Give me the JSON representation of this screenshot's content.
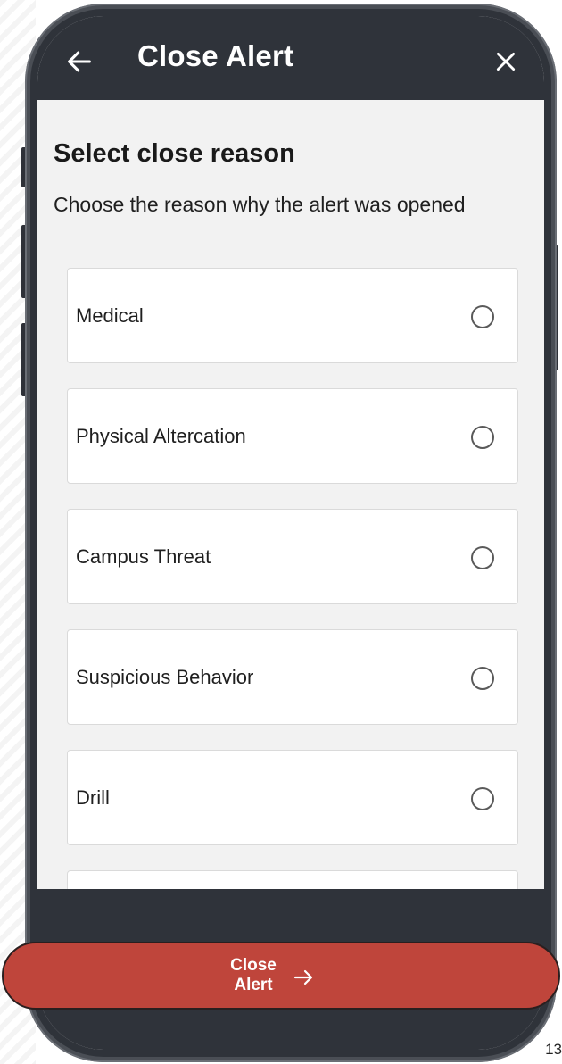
{
  "header": {
    "title": "Close Alert"
  },
  "main": {
    "heading": "Select close reason",
    "subheading": "Choose the reason why the alert was opened",
    "options": [
      {
        "label": "Medical",
        "selected": false
      },
      {
        "label": "Physical Altercation",
        "selected": false
      },
      {
        "label": "Campus Threat",
        "selected": false
      },
      {
        "label": "Suspicious Behavior",
        "selected": false
      },
      {
        "label": "Drill",
        "selected": false
      },
      {
        "label": "",
        "selected": false
      }
    ]
  },
  "footer": {
    "cta_label": "Close\nAlert"
  },
  "page_number": "13",
  "icons": {
    "back": "arrow-left-icon",
    "close": "close-icon",
    "cta_arrow": "arrow-right-icon",
    "radio": "radio-unchecked-icon"
  },
  "colors": {
    "app_bar": "#2f333a",
    "background": "#f2f2f2",
    "card": "#ffffff",
    "card_border": "#dadada",
    "cta": "#bf453b",
    "text": "#1f1f1f"
  }
}
